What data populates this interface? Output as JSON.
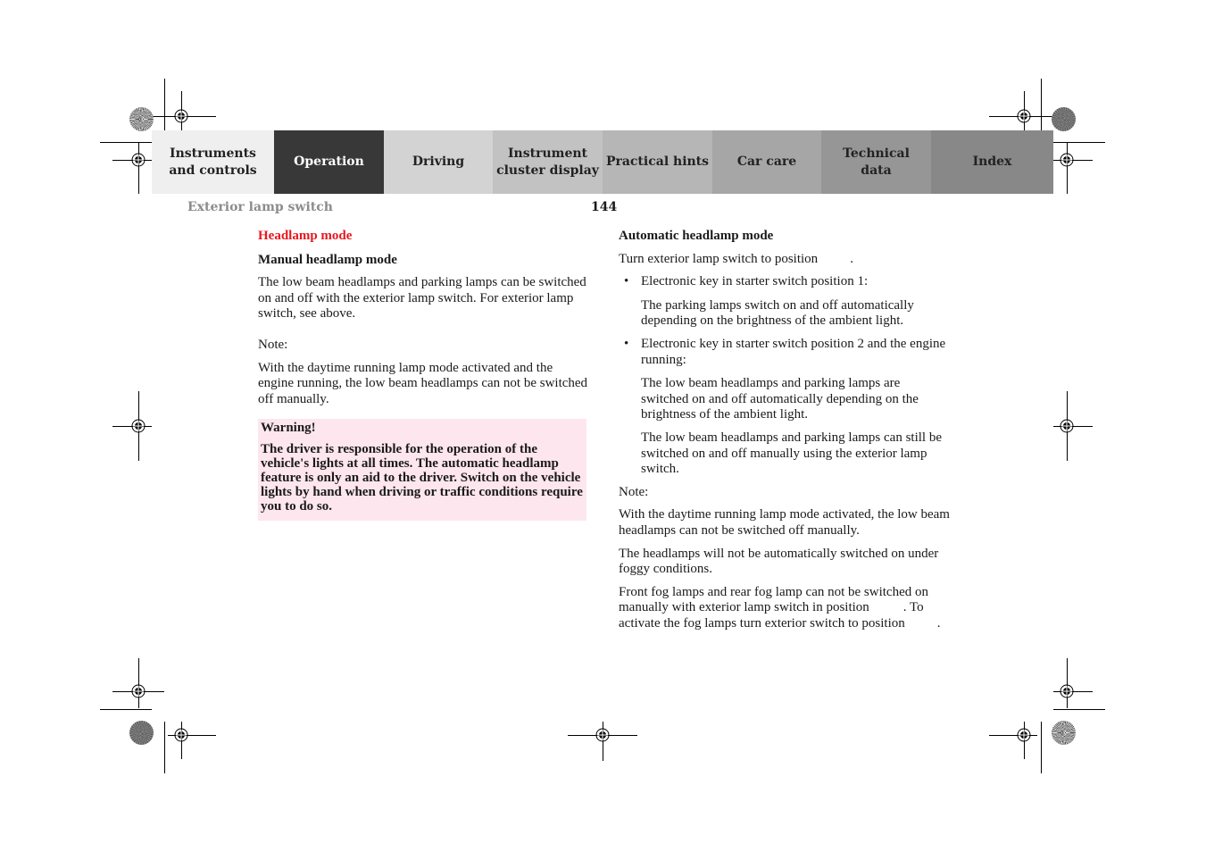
{
  "nav": {
    "tabs": [
      {
        "label": "Instruments\nand controls",
        "bg": "#efefef",
        "active": false
      },
      {
        "label": "Operation",
        "bg": "#383838",
        "active": true
      },
      {
        "label": "Driving",
        "bg": "#d3d3d3",
        "active": false
      },
      {
        "label": "Instrument\ncluster display",
        "bg": "#c2c2c2",
        "active": false
      },
      {
        "label": "Practical hints",
        "bg": "#b6b6b6",
        "active": false
      },
      {
        "label": "Car care",
        "bg": "#a6a6a6",
        "active": false
      },
      {
        "label": "Technical\ndata",
        "bg": "#969696",
        "active": false
      },
      {
        "label": "Index",
        "bg": "#888888",
        "active": false
      }
    ]
  },
  "header": {
    "section_title": "Exterior lamp switch",
    "page_number": "144"
  },
  "left": {
    "heading": "Headlamp mode",
    "subheading": "Manual headlamp mode",
    "para1": "The low beam headlamps and parking lamps can be switched on and off with the exterior lamp switch. For exterior lamp switch, see above.",
    "note_label": "Note:",
    "note_text": "With the daytime running lamp mode activated and the engine running, the low beam headlamps can not be switched off manually.",
    "warning": {
      "title": "Warning!",
      "text": "The driver is responsible for the operation of the vehicle's lights at all times. The automatic headlamp feature is only an aid to the driver. Switch on the vehicle lights by hand when driving or traffic conditions require you to do so.",
      "bg": "#fde6ee"
    }
  },
  "right": {
    "heading": "Automatic headlamp mode",
    "intro": "Turn exterior lamp switch to position",
    "intro_end": ".",
    "bullets": [
      {
        "bullet": "•",
        "text": "Electronic key in starter switch position 1:",
        "details": [
          "The parking lamps switch on and off automatically depending on the brightness of the ambient light."
        ]
      },
      {
        "bullet": "•",
        "text": "Electronic key in starter switch position 2 and the engine running:",
        "details": [
          "The low beam headlamps and parking lamps are switched on and off automatically depending on the brightness of the ambient light.",
          "The low beam headlamps and parking lamps can still be switched on and off manually using the exterior lamp switch."
        ]
      }
    ],
    "note_label": "Note:",
    "note_text": "With the daytime running lamp mode activated, the low beam headlamps can not be switched off manually.",
    "fog_note": "The headlamps will not be automatically switched on under foggy conditions.",
    "fog_para_a": "Front fog lamps and rear fog lamp can not be switched on manually with exterior lamp switch in position",
    "fog_para_a_end": ".",
    "fog_para_b": "To activate the fog lamps turn exterior switch to position",
    "fog_para_b_end": "."
  },
  "colors": {
    "heading_red": "#e8171e",
    "section_title_grey": "#8c8c8c"
  }
}
